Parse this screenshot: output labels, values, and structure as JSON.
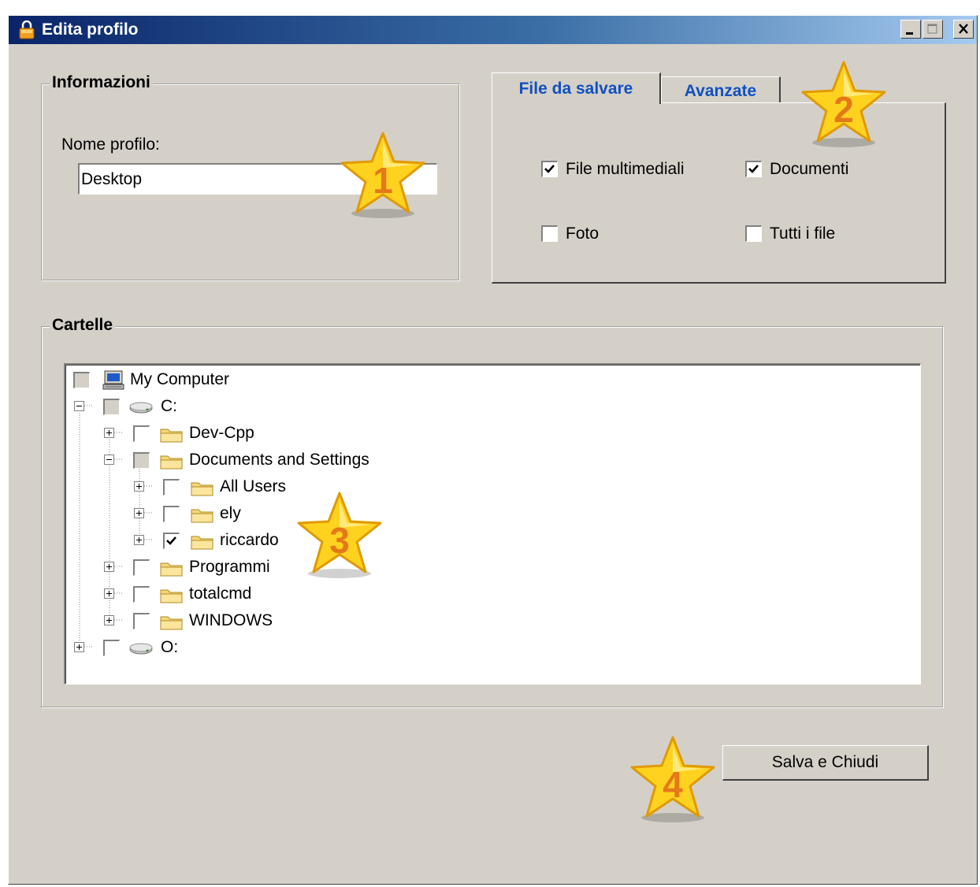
{
  "window": {
    "title": "Edita profilo"
  },
  "info": {
    "legend": "Informazioni",
    "name_label": "Nome profilo:",
    "name_value": "Desktop"
  },
  "tabs": [
    {
      "label": "File da salvare",
      "selected": true
    },
    {
      "label": "Avanzate",
      "selected": false
    }
  ],
  "filetypes": [
    {
      "label": "File multimediali",
      "checked": true
    },
    {
      "label": "Documenti",
      "checked": true
    },
    {
      "label": "Foto",
      "checked": false
    },
    {
      "label": "Tutti i file",
      "checked": false
    }
  ],
  "folders": {
    "legend": "Cartelle",
    "nodes": [
      {
        "label": "My Computer",
        "icon": "computer-icon",
        "check": "unchecked"
      },
      {
        "label": "C:",
        "icon": "drive-icon",
        "check": "partial",
        "expander": "collapse"
      },
      {
        "label": "Dev-Cpp",
        "icon": "folder-icon",
        "check": "unchecked",
        "expander": "expand"
      },
      {
        "label": "Documents and Settings",
        "icon": "folder-icon",
        "check": "partial",
        "expander": "collapse"
      },
      {
        "label": "All Users",
        "icon": "folder-icon",
        "check": "unchecked",
        "expander": "expand"
      },
      {
        "label": "ely",
        "icon": "folder-icon",
        "check": "unchecked",
        "expander": "expand"
      },
      {
        "label": "riccardo",
        "icon": "folder-icon",
        "check": "checked",
        "expander": "expand"
      },
      {
        "label": "Programmi",
        "icon": "folder-icon",
        "check": "unchecked",
        "expander": "expand"
      },
      {
        "label": "totalcmd",
        "icon": "folder-icon",
        "check": "unchecked",
        "expander": "expand"
      },
      {
        "label": "WINDOWS",
        "icon": "folder-icon",
        "check": "unchecked",
        "expander": "expand"
      },
      {
        "label": "O:",
        "icon": "drive-icon",
        "check": "unchecked",
        "expander": "expand"
      }
    ]
  },
  "save_button": "Salva e Chiudi",
  "callouts": [
    "1",
    "2",
    "3",
    "4"
  ]
}
